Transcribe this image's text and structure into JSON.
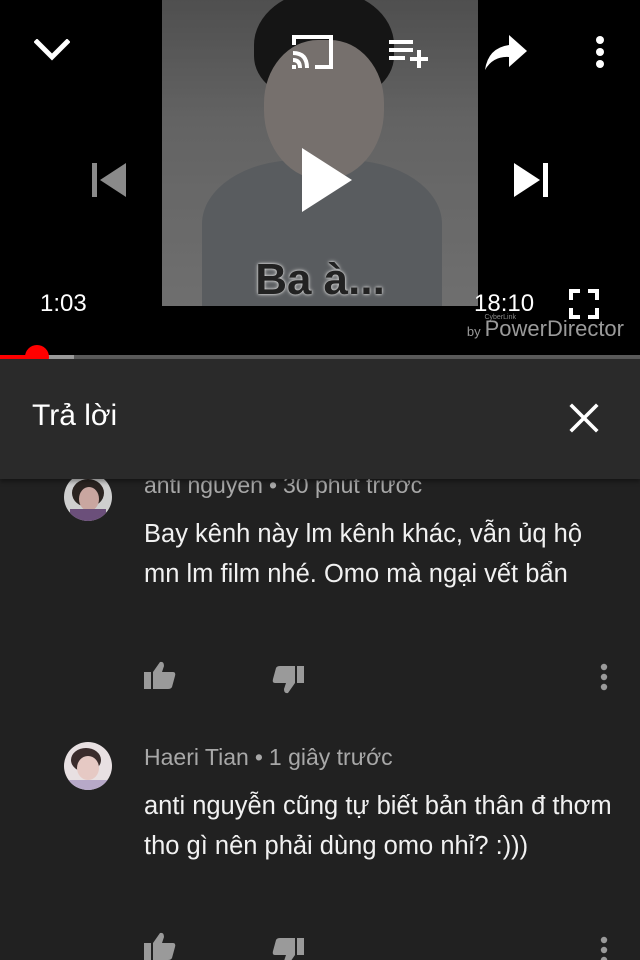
{
  "app": "YouTube",
  "player": {
    "current_time": "1:03",
    "duration": "18:10",
    "thumbnail_caption": "Ba à...",
    "progress_fraction": 0.0578,
    "buffered_fraction": 0.115,
    "watermark": {
      "small": "CyberLink",
      "by": "by",
      "brand": "PowerDirector"
    },
    "icons": {
      "minimize": "chevron-down-icon",
      "cast": "cast-icon",
      "add_to_queue": "playlist-add-icon",
      "share": "share-icon",
      "more": "more-vertical-icon",
      "previous": "skip-previous-icon",
      "play": "play-icon",
      "next": "skip-next-icon",
      "fullscreen": "fullscreen-icon"
    },
    "colors": {
      "progress_played": "#ff0000",
      "progress_buffered": "#9a9a9a",
      "progress_track": "#5a5a5a"
    }
  },
  "reply_panel": {
    "title": "Trả lời",
    "close_icon": "close-icon"
  },
  "comments": [
    {
      "author": "anti nguyen",
      "time": "30 phút trước",
      "separator": "•",
      "text": "Bay kênh này lm kênh khác, vẫn ủq hộ mn lm film nhé. Omo mà ngại vết bẩn",
      "avatar": "user-avatar"
    },
    {
      "author": "Haeri Tian",
      "time": "1 giây trước",
      "separator": "•",
      "text": "anti nguyễn cũng tự biết bản thân đ thơm tho gì nên phải dùng omo nhỉ? :)))",
      "avatar": "user-avatar"
    }
  ],
  "theme": {
    "background": "#212121",
    "panel": "#2a2a2a",
    "text_primary": "#f1f1f1",
    "text_secondary": "#a8a8a8"
  }
}
